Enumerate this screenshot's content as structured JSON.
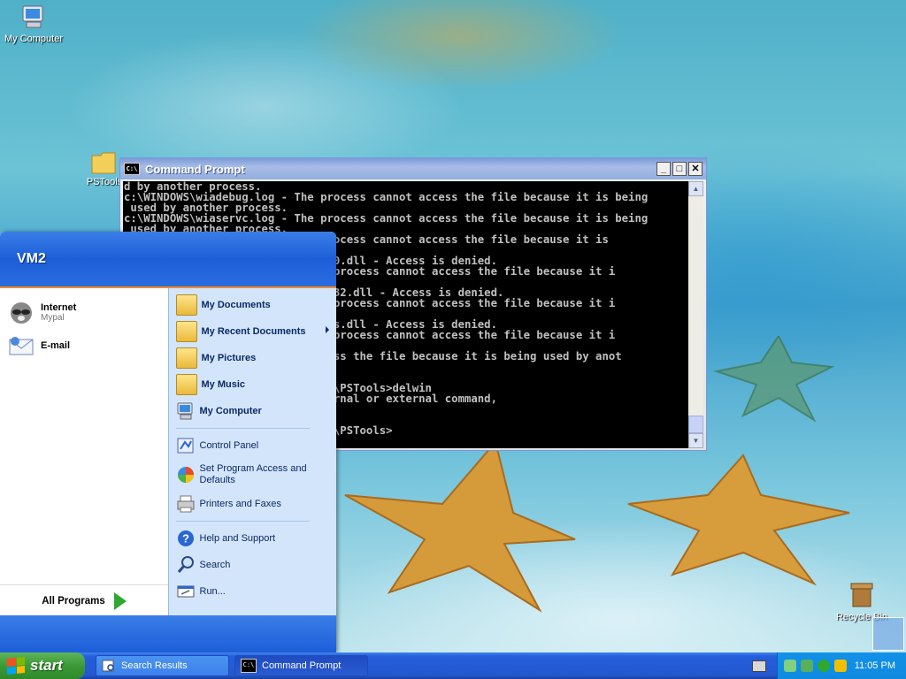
{
  "desktop": {
    "icons": [
      {
        "label": "My Computer"
      },
      {
        "label": "PSTools"
      },
      {
        "label": "Recycle Bin"
      }
    ]
  },
  "cmd": {
    "title": "Command Prompt",
    "lines": [
      "d by another process.",
      "c:\\WINDOWS\\wiadebug.log - The process cannot access the file because it is being",
      " used by another process.",
      "c:\\WINDOWS\\wiaservc.log - The process cannot access the file because it is being",
      " used by another process.",
      "                          The process cannot access the file because it is",
      "",
      "                         \\msvcr80.dll - Access is denied.",
      "                          - The process cannot access the file because it i",
      "                          s.",
      "                         \\comctl32.dll - Access is denied.",
      "                          - The process cannot access the file because it i",
      "                          s.",
      "                         \\GdiPlus.dll - Access is denied.",
      "                          - The process cannot access the file because it i",
      "                          s.",
      "                          t access the file because it is being used by anot",
      "",
      "",
      "                         Desktop\\PSTools>delwin",
      "                         an internal or external command,",
      "",
      "",
      "                         Desktop\\PSTools>"
    ]
  },
  "startmenu": {
    "user": "VM2",
    "pinned": [
      {
        "title": "Internet",
        "subtitle": "Mypal"
      },
      {
        "title": "E-mail",
        "subtitle": ""
      }
    ],
    "all_programs": "All Programs",
    "places": [
      {
        "label": "My Documents"
      },
      {
        "label": "My Recent Documents"
      },
      {
        "label": "My Pictures"
      },
      {
        "label": "My Music"
      },
      {
        "label": "My Computer"
      }
    ],
    "settings": [
      {
        "label": "Control Panel"
      },
      {
        "label": "Set Program Access and Defaults"
      },
      {
        "label": "Printers and Faxes"
      }
    ],
    "help": [
      {
        "label": "Help and Support"
      },
      {
        "label": "Search"
      },
      {
        "label": "Run..."
      }
    ]
  },
  "taskbar": {
    "start_label": "start",
    "tasks": [
      {
        "label": "Search Results"
      },
      {
        "label": "Command Prompt"
      }
    ],
    "clock": "11:05 PM"
  },
  "colors": {
    "accent": "#245edb",
    "start_green": "#3a9a36",
    "menu_separator": "#f08a24"
  }
}
